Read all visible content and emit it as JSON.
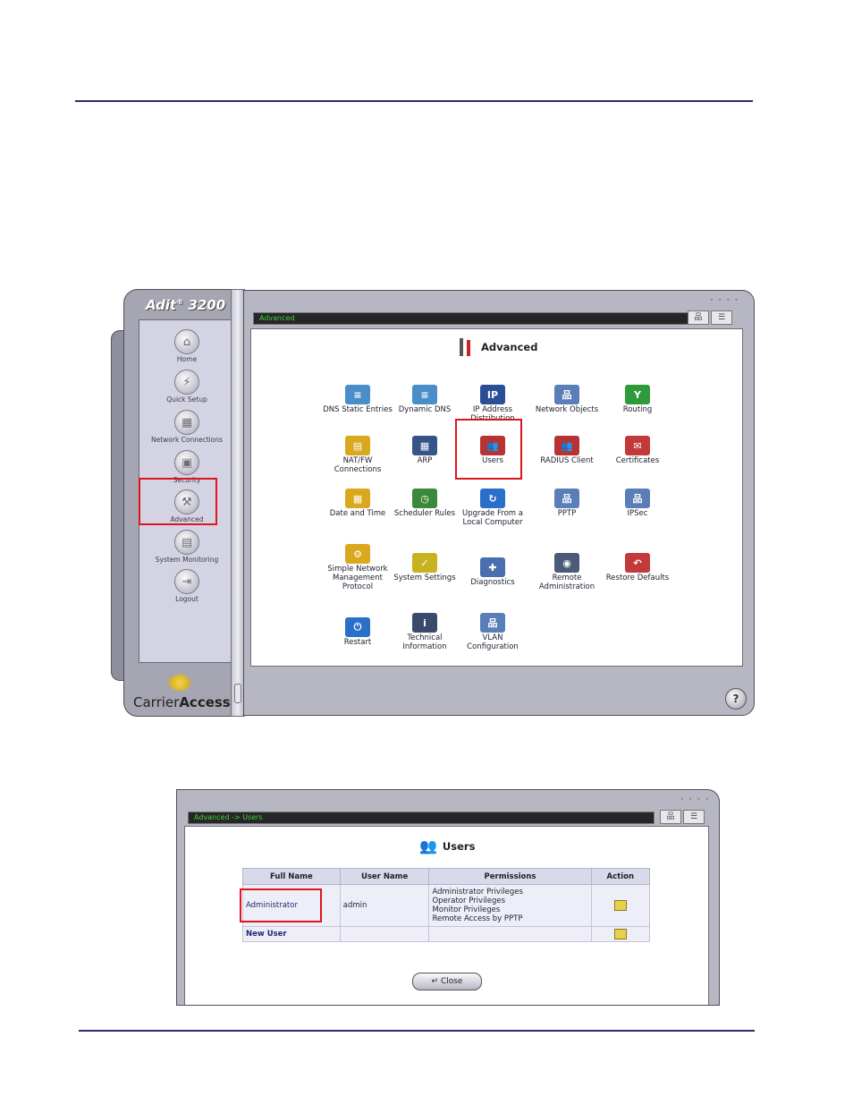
{
  "app": {
    "brand": "Adit",
    "brand_reg": "®",
    "brand_model": "3200",
    "breadcrumb": "Advanced",
    "logo_text_1": "Carrier",
    "logo_text_2": "Access",
    "help_label": "?"
  },
  "sidebar": {
    "items": [
      {
        "label": "Home",
        "icon": "home-icon"
      },
      {
        "label": "Quick Setup",
        "icon": "lightning-icon"
      },
      {
        "label": "Network Connections",
        "icon": "network-icon"
      },
      {
        "label": "Security",
        "icon": "lock-icon"
      },
      {
        "label": "Advanced",
        "icon": "tools-icon"
      },
      {
        "label": "System Monitoring",
        "icon": "monitor-icon"
      },
      {
        "label": "Logout",
        "icon": "logout-icon"
      }
    ]
  },
  "main": {
    "title": "Advanced",
    "grid": [
      {
        "label": "DNS Static Entries",
        "icon": "dns-icon",
        "color": "#4a8ec9"
      },
      {
        "label": "Dynamic DNS",
        "icon": "dynamic-dns-icon",
        "color": "#4a8ec9"
      },
      {
        "label": "IP Address Distribution",
        "icon": "ip-icon",
        "color": "#2a4f96"
      },
      {
        "label": "Network Objects",
        "icon": "network-objects-icon",
        "color": "#5a7fb8"
      },
      {
        "label": "Routing",
        "icon": "routing-icon",
        "color": "#2f9a3a"
      },
      {
        "label": "NAT/FW Connections",
        "icon": "nat-icon",
        "color": "#d9a81f"
      },
      {
        "label": "ARP",
        "icon": "arp-icon",
        "color": "#34548a"
      },
      {
        "label": "Users",
        "icon": "users-icon",
        "color": "#b83232"
      },
      {
        "label": "RADIUS Client",
        "icon": "radius-icon",
        "color": "#b83232"
      },
      {
        "label": "Certificates",
        "icon": "certificate-icon",
        "color": "#c23a3a"
      },
      {
        "label": "Date and Time",
        "icon": "calendar-icon",
        "color": "#d9a81f"
      },
      {
        "label": "Scheduler Rules",
        "icon": "clock-icon",
        "color": "#3b8a3b"
      },
      {
        "label": "Upgrade From a Local Computer",
        "icon": "upgrade-icon",
        "color": "#2a6fc9"
      },
      {
        "label": "PPTP",
        "icon": "pptp-icon",
        "color": "#5a7fb8"
      },
      {
        "label": "IPSec",
        "icon": "ipsec-icon",
        "color": "#5a7fb8"
      },
      {
        "label": "Simple Network Management Protocol",
        "icon": "snmp-icon",
        "color": "#d9a81f"
      },
      {
        "label": "System Settings",
        "icon": "settings-icon",
        "color": "#c9b21f"
      },
      {
        "label": "Diagnostics",
        "icon": "diagnostics-icon",
        "color": "#4a6fb0"
      },
      {
        "label": "Remote Administration",
        "icon": "remote-admin-icon",
        "color": "#4a5a78"
      },
      {
        "label": "Restore Defaults",
        "icon": "restore-icon",
        "color": "#c23a3a"
      },
      {
        "label": "Restart",
        "icon": "power-icon",
        "color": "#2a6fc9"
      },
      {
        "label": "Technical Information",
        "icon": "info-icon",
        "color": "#3a4a6a"
      },
      {
        "label": "VLAN Configuration",
        "icon": "vlan-icon",
        "color": "#5a7fb8"
      }
    ]
  },
  "users_dialog": {
    "breadcrumb": "Advanced -> Users",
    "title": "Users",
    "columns": [
      "Full Name",
      "User Name",
      "Permissions",
      "Action"
    ],
    "rows": [
      {
        "full_name": "Administrator",
        "user_name": "admin",
        "permissions": [
          "Administrator Privileges",
          "Operator Privileges",
          "Monitor Privileges",
          "Remote Access by PPTP"
        ]
      }
    ],
    "new_user_label": "New User",
    "close_label": "Close"
  }
}
